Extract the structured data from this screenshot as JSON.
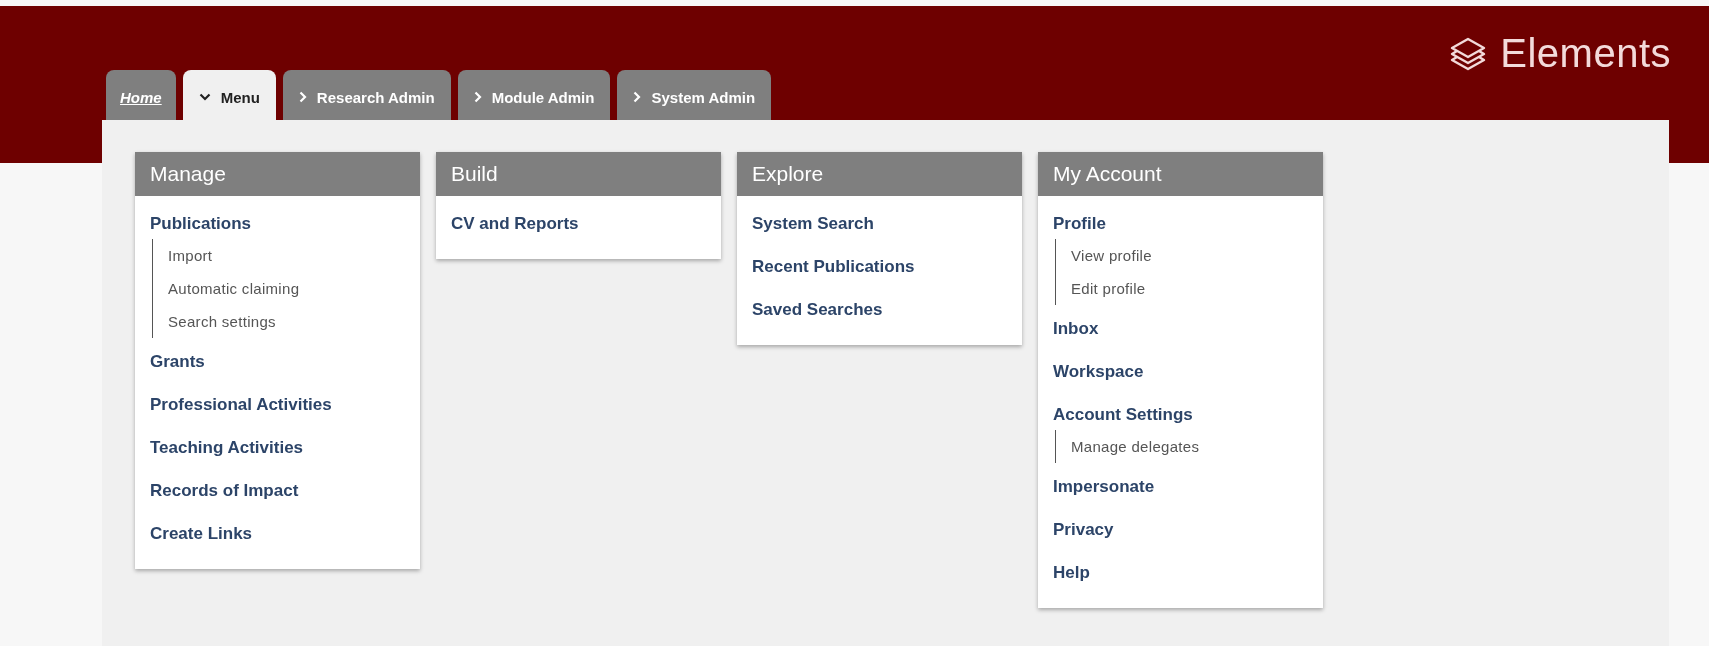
{
  "logo": {
    "text": "Elements"
  },
  "tabs": [
    {
      "label": "Home",
      "kind": "home",
      "selected": false
    },
    {
      "label": "Menu",
      "kind": "dropdown",
      "selected": true
    },
    {
      "label": "Research Admin",
      "kind": "link",
      "selected": false
    },
    {
      "label": "Module Admin",
      "kind": "link",
      "selected": false
    },
    {
      "label": "System Admin",
      "kind": "link",
      "selected": false
    }
  ],
  "menu_columns": [
    {
      "title": "Manage",
      "items": [
        {
          "label": "Publications",
          "children": [
            {
              "label": "Import"
            },
            {
              "label": "Automatic claiming"
            },
            {
              "label": "Search settings"
            }
          ]
        },
        {
          "label": "Grants"
        },
        {
          "label": "Professional Activities"
        },
        {
          "label": "Teaching Activities"
        },
        {
          "label": "Records of Impact"
        },
        {
          "label": "Create Links"
        }
      ]
    },
    {
      "title": "Build",
      "items": [
        {
          "label": "CV and Reports"
        }
      ]
    },
    {
      "title": "Explore",
      "items": [
        {
          "label": "System Search"
        },
        {
          "label": "Recent Publications"
        },
        {
          "label": "Saved Searches"
        }
      ]
    },
    {
      "title": "My Account",
      "items": [
        {
          "label": "Profile",
          "children": [
            {
              "label": "View profile"
            },
            {
              "label": "Edit profile"
            }
          ]
        },
        {
          "label": "Inbox"
        },
        {
          "label": "Workspace"
        },
        {
          "label": "Account Settings",
          "children": [
            {
              "label": "Manage delegates"
            }
          ]
        },
        {
          "label": "Impersonate"
        },
        {
          "label": "Privacy"
        },
        {
          "label": "Help"
        }
      ]
    }
  ]
}
